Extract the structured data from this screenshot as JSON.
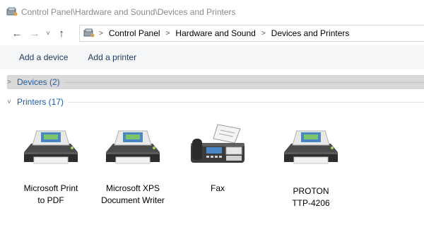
{
  "title_bar": {
    "path_text": "Control Panel\\Hardware and Sound\\Devices and Printers",
    "icon": "control-panel-icon"
  },
  "nav": {
    "back": "←",
    "forward": "→",
    "recent": "˅",
    "up": "↑"
  },
  "address": {
    "icon": "control-panel-icon",
    "crumbs": [
      "Control Panel",
      "Hardware and Sound",
      "Devices and Printers"
    ],
    "separator": ">"
  },
  "commands": {
    "add_device": "Add a device",
    "add_printer": "Add a printer"
  },
  "groups": {
    "devices": {
      "label": "Devices (2)",
      "chevron": ">",
      "state": "collapsed"
    },
    "printers": {
      "label": "Printers (17)",
      "chevron": "˅",
      "state": "expanded"
    }
  },
  "printers": [
    {
      "line1": "Microsoft Print",
      "line2": "to PDF",
      "icon": "printer-icon"
    },
    {
      "line1": "Microsoft XPS",
      "line2": "Document Writer",
      "icon": "printer-icon"
    },
    {
      "line1": "Fax",
      "line2": "",
      "icon": "fax-icon"
    },
    {
      "line1": "PROTON",
      "line2": "TTP-4206",
      "icon": "printer-icon"
    }
  ],
  "colors": {
    "link": "#1e5aa8",
    "command": "#1e395b",
    "collapsed_group_bg": "#d9d9d9",
    "command_bar_bg": "#f5f6f7"
  }
}
